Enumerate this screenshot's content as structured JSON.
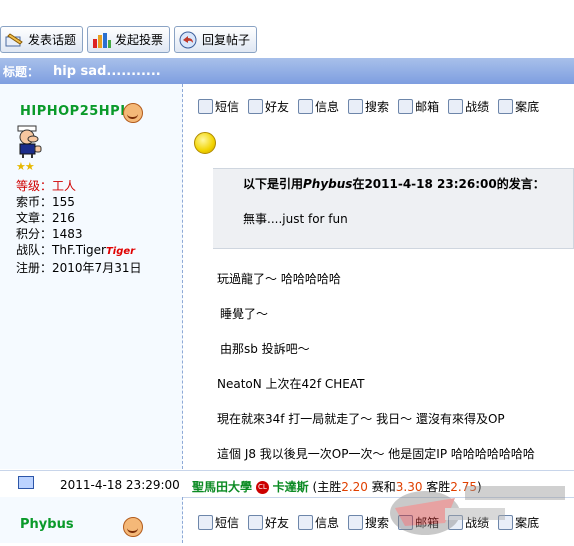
{
  "toolbar": {
    "new_topic": "发表话题",
    "new_poll": "发起投票",
    "reply": "回复帖子"
  },
  "topic": {
    "label": "标题：",
    "title": "hip sad..........."
  },
  "user1": {
    "name": "HIPHOP25HPI",
    "level_label": "等级：",
    "level": "工人",
    "coins_label": "索币：",
    "coins": "155",
    "posts_label": "文章：",
    "posts": "216",
    "points_label": "积分：",
    "points": "1483",
    "team_label": "战队：",
    "team": "ThF.Tiger",
    "team_badge": "Tiger",
    "reg_label": "注册：",
    "reg_date": "2010年7月31日"
  },
  "actions": [
    "短信",
    "好友",
    "信息",
    "搜索",
    "邮箱",
    "战绩",
    "案底"
  ],
  "quote": {
    "prefix": "以下是引用",
    "author": "Phybus",
    "suffix": "在2011-4-18 23:26:00的发言：",
    "body": "無事....just for fun"
  },
  "post_lines": [
    "玩過龍了～ 哈哈哈哈哈",
    "睡覺了～",
    "由那sb 投訴吧～",
    "NeatoN 上次在42f CHEAT",
    "現在就來34f 打一局就走了～ 我日～ 還沒有來得及OP",
    "這個 J8 我以後見一次OP一次～  他是固定IP  哈哈哈哈哈哈哈"
  ],
  "footer": {
    "datetime": "2011-4-18 23:29:00",
    "ad_team1": "聖馬田大學",
    "ad_badge": "CL",
    "ad_team2": "卡達斯",
    "ad_odds_prefix": "(主胜",
    "ad_home": "2.20",
    "ad_mid": " 赛和",
    "ad_draw": "3.30",
    "ad_mid2": " 客胜",
    "ad_away": "2.75",
    "ad_close": ")"
  },
  "user2": {
    "name": "Phybus"
  },
  "colors": {
    "title_bar": "#7e9ee0",
    "username": "#0a9a2a",
    "level_red": "#d00000",
    "odds_red": "#e04000"
  }
}
